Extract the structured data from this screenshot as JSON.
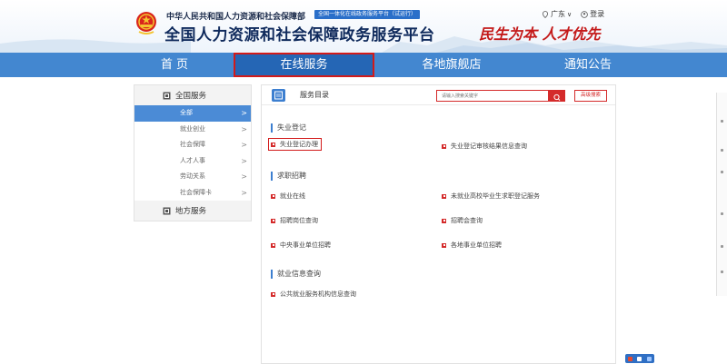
{
  "header": {
    "ministry": "中华人民共和国人力资源和社会保障部",
    "beta_badge": "全国一体化在线政务服务平台（试运行）",
    "platform_title": "全国人力资源和社会保障政务服务平台",
    "slogan": "民生为本 人才优先",
    "region_label": "广东",
    "login_label": "登录"
  },
  "nav": {
    "items": [
      "首 页",
      "在线服务",
      "各地旗舰店",
      "通知公告"
    ],
    "active_index": 1
  },
  "sidebar": {
    "national": "全国服务",
    "subitems": [
      "全部",
      "就业创业",
      "社会保障",
      "人才人事",
      "劳动关系",
      "社会保障卡"
    ],
    "active_index": 0,
    "local": "地方服务"
  },
  "main": {
    "directory_title": "服务目录",
    "search_placeholder": "请输入搜索关键字",
    "advanced_search": "高级搜索",
    "categories": [
      {
        "title": "失业登记",
        "services": [
          "失业登记办理",
          "失业登记审核结果信息查询"
        ]
      },
      {
        "title": "求职招聘",
        "services": [
          "就业在线",
          "未就业高校毕业生求职登记服务",
          "招聘岗位查询",
          "招聘会查询",
          "中央事业单位招聘",
          "各地事业单位招聘"
        ]
      },
      {
        "title": "就业信息查询",
        "services": [
          "公共就业服务机构信息查询"
        ]
      }
    ]
  },
  "colors": {
    "nav_bg": "#4387d0",
    "accent_red": "#d42a2a",
    "active_blue": "#4b8bd6"
  }
}
